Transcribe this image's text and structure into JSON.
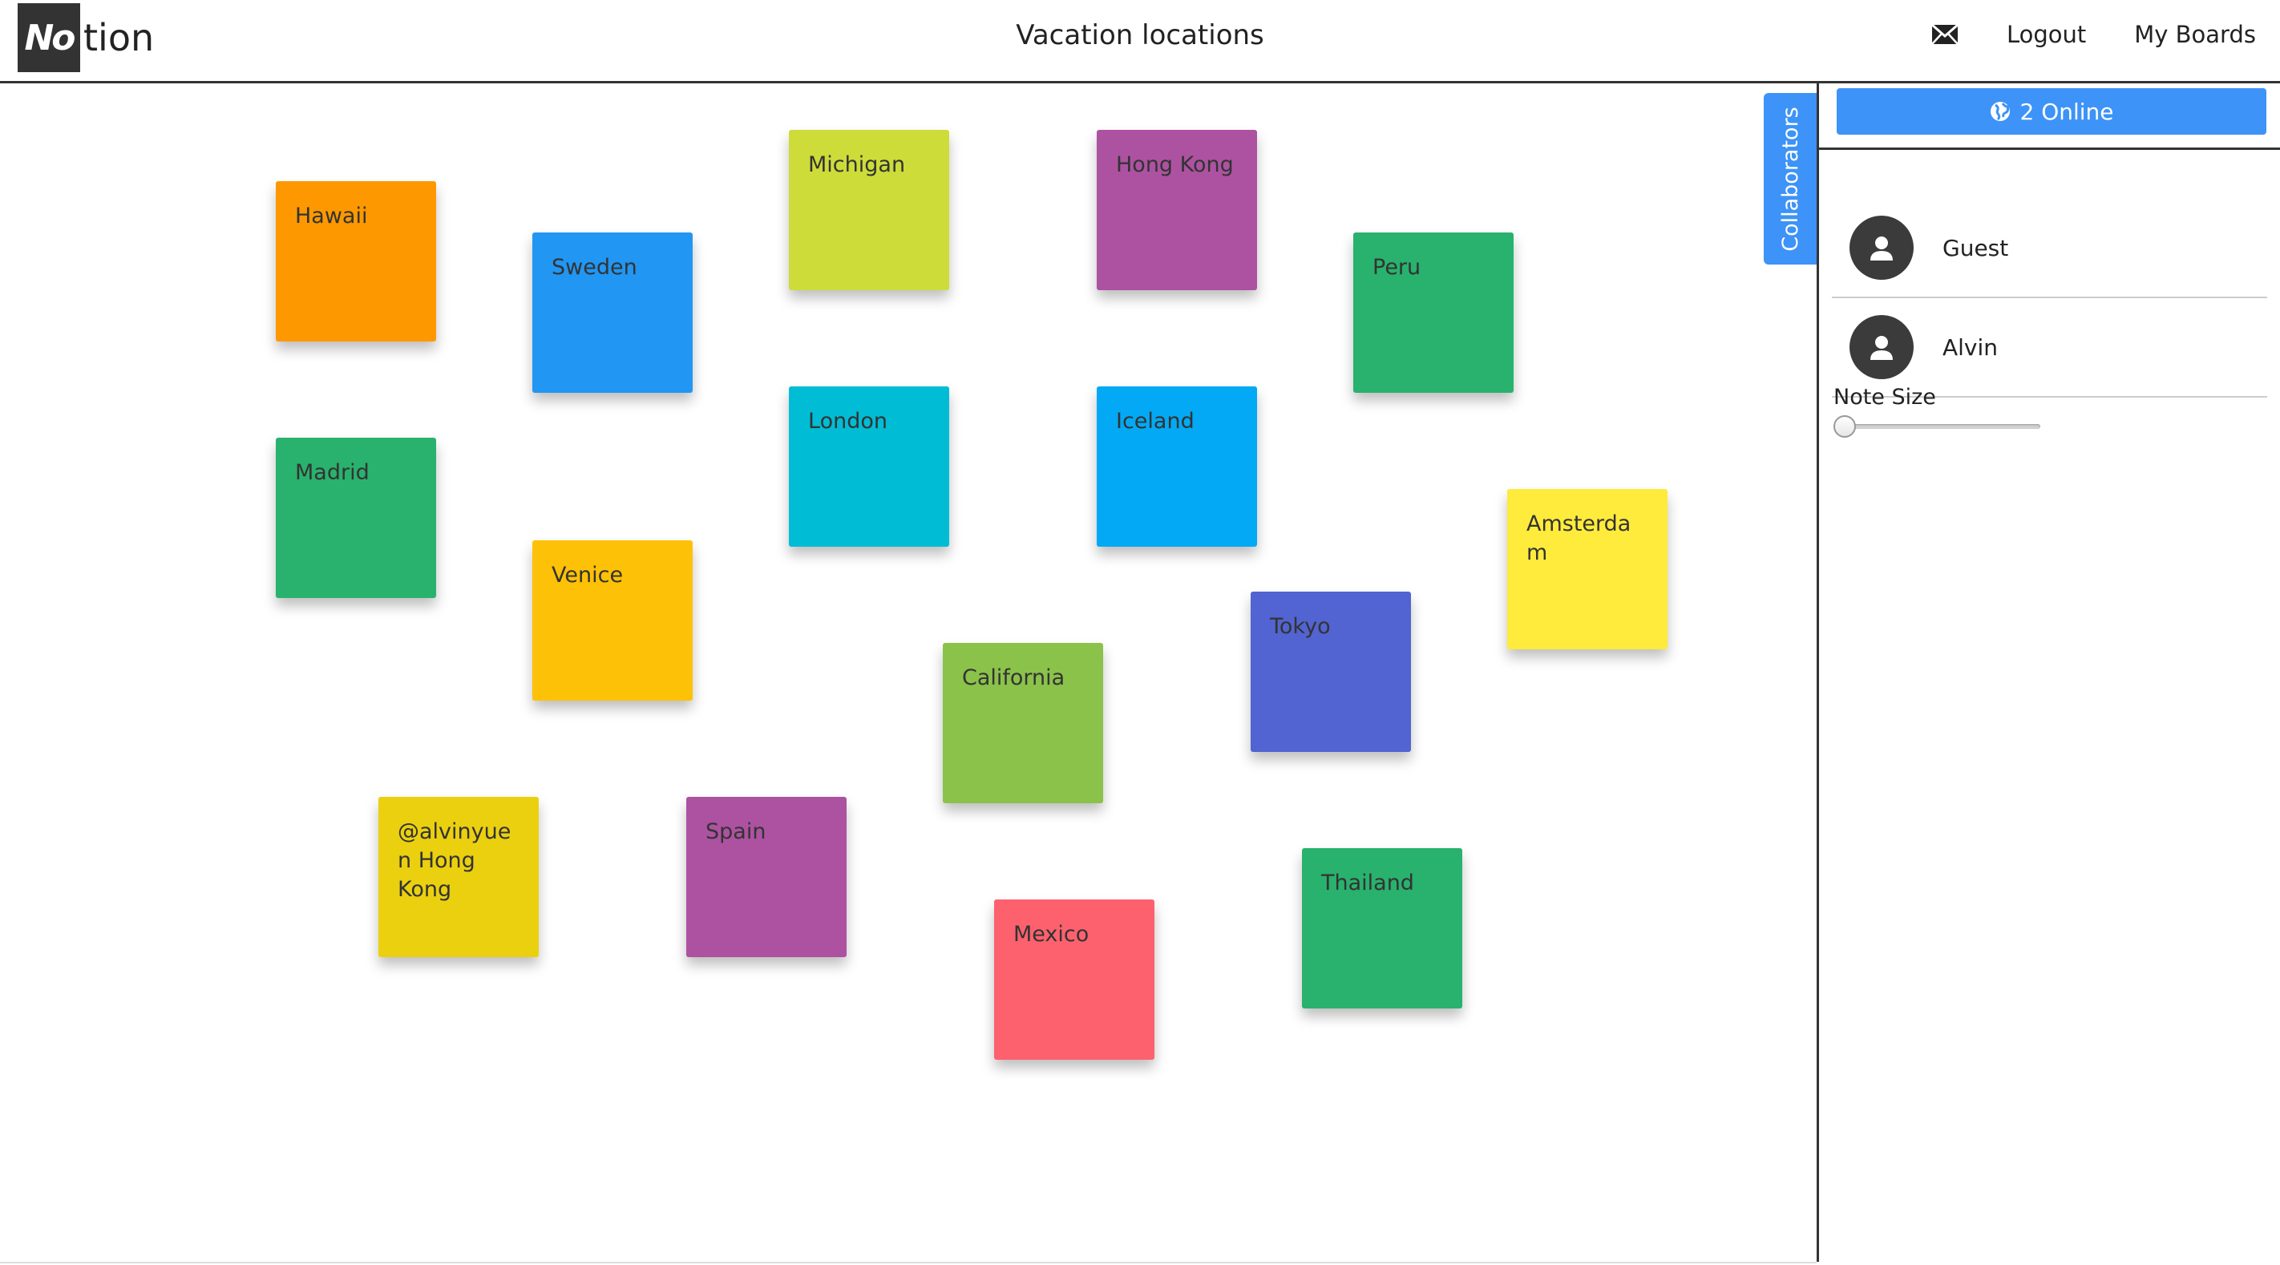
{
  "header": {
    "logo_text": "tion",
    "board_title": "Vacation locations",
    "nav": {
      "logout_label": "Logout",
      "my_boards_label": "My Boards"
    },
    "icons": {
      "mail": "mail-icon"
    }
  },
  "colors": {
    "accent": "#3d93f7",
    "dark": "#333333"
  },
  "notes": [
    {
      "text": "Hawaii",
      "color": "#fe9800"
    },
    {
      "text": "Sweden",
      "color": "#2196f3"
    },
    {
      "text": "Michigan",
      "color": "#cddc39"
    },
    {
      "text": "Hong Kong",
      "color": "#ad52a1"
    },
    {
      "text": "Peru",
      "color": "#28b26d"
    },
    {
      "text": "Madrid",
      "color": "#28b26d"
    },
    {
      "text": "London",
      "color": "#00bcd4"
    },
    {
      "text": "Iceland",
      "color": "#03a9f4"
    },
    {
      "text": "Venice",
      "color": "#fdc107"
    },
    {
      "text": "Amsterdam",
      "color": "#ffeb3b"
    },
    {
      "text": "Tokyo",
      "color": "#5164d1"
    },
    {
      "text": "California",
      "color": "#8bc24a"
    },
    {
      "text": "@alvinyuen Hong Kong",
      "color": "#ebd00f"
    },
    {
      "text": "Spain",
      "color": "#ad52a1"
    },
    {
      "text": "Thailand",
      "color": "#28b26d"
    },
    {
      "text": "Mexico",
      "color": "#fd616e"
    }
  ],
  "sidebar": {
    "collaborators_tab_label": "Collaborators",
    "online_label": "2 Online",
    "users": [
      {
        "name": "Guest"
      },
      {
        "name": "Alvin"
      }
    ],
    "note_size_label": "Note Size",
    "note_size_value": 0
  }
}
